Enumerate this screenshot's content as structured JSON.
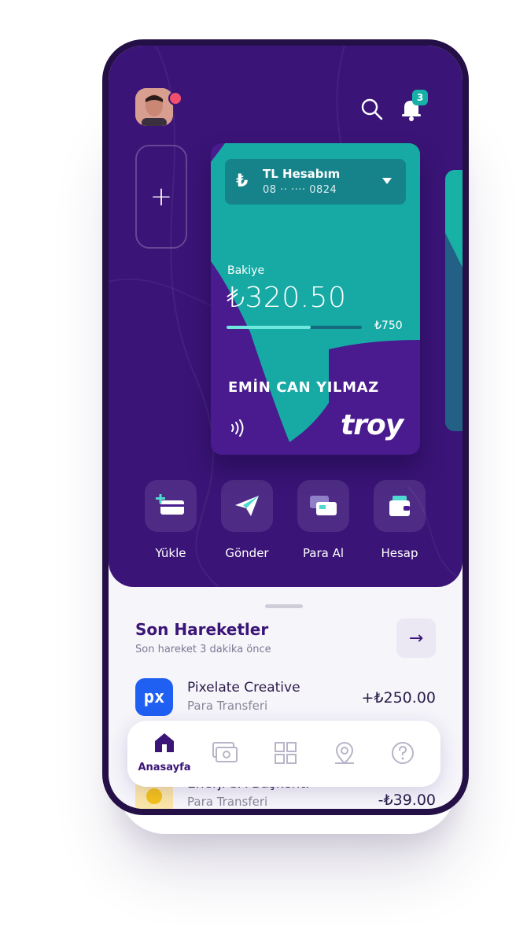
{
  "header": {
    "notification_count": "3"
  },
  "add_card": {
    "label": "+"
  },
  "card": {
    "currency_symbol": "₺",
    "account_name": "TL Hesabım",
    "account_number": "08 ·· ···· 0824",
    "balance_label": "Bakiye",
    "balance_value": "₺320.50",
    "limit_label": "₺750",
    "limit_fill_fraction": 0.62,
    "holder_name": "EMİN CAN YILMAZ",
    "brand": "troy"
  },
  "actions": [
    {
      "label": "Yükle",
      "icon": "top-up-icon"
    },
    {
      "label": "Gönder",
      "icon": "send-icon"
    },
    {
      "label": "Para Al",
      "icon": "request-money-icon"
    },
    {
      "label": "Hesap",
      "icon": "wallet-icon"
    }
  ],
  "recent": {
    "title": "Son Hareketler",
    "subtitle": "Son hareket 3 dakika önce",
    "view_all_label": "→",
    "transactions": [
      {
        "logo": "px",
        "name": "Pixelate Creative",
        "type": "Para Transferi",
        "amount": "+₺250.00"
      },
      {
        "logo": "",
        "name": "Enerji SA Başkent.",
        "type": "Para Transferi",
        "amount": "-₺39.00"
      }
    ]
  },
  "nav": {
    "home_label": "Anasayfa",
    "items": [
      "home-icon",
      "cards-icon",
      "grid-icon",
      "location-icon",
      "help-icon"
    ]
  },
  "colors": {
    "primary_purple": "#3a1477",
    "card_purple": "#4a1a8f",
    "teal": "#17b0a7",
    "badge_red": "#f0506e"
  }
}
